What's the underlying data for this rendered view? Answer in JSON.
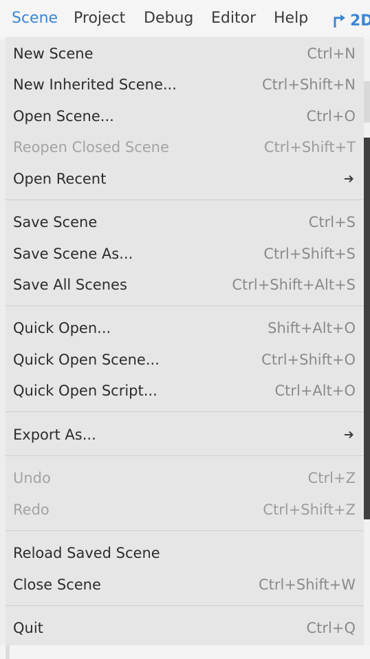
{
  "menubar": {
    "items": [
      {
        "label": "Scene"
      },
      {
        "label": "Project"
      },
      {
        "label": "Debug"
      },
      {
        "label": "Editor"
      },
      {
        "label": "Help"
      }
    ],
    "mode_label": "2D",
    "mode_icon": "2d-mode-icon",
    "accent_color": "#3a86d6"
  },
  "scene_menu": {
    "items": [
      {
        "label": "New Scene",
        "shortcut": "Ctrl+N"
      },
      {
        "label": "New Inherited Scene...",
        "shortcut": "Ctrl+Shift+N"
      },
      {
        "label": "Open Scene...",
        "shortcut": "Ctrl+O"
      },
      {
        "label": "Reopen Closed Scene",
        "shortcut": "Ctrl+Shift+T",
        "disabled": true
      },
      {
        "label": "Open Recent",
        "submenu_icon": "arrow-right-icon"
      },
      {
        "label": "Save Scene",
        "shortcut": "Ctrl+S"
      },
      {
        "label": "Save Scene As...",
        "shortcut": "Ctrl+Shift+S"
      },
      {
        "label": "Save All Scenes",
        "shortcut": "Ctrl+Shift+Alt+S"
      },
      {
        "label": "Quick Open...",
        "shortcut": "Shift+Alt+O"
      },
      {
        "label": "Quick Open Scene...",
        "shortcut": "Ctrl+Shift+O"
      },
      {
        "label": "Quick Open Script...",
        "shortcut": "Ctrl+Alt+O"
      },
      {
        "label": "Export As...",
        "submenu_icon": "arrow-right-icon"
      },
      {
        "label": "Undo",
        "shortcut": "Ctrl+Z",
        "disabled": true
      },
      {
        "label": "Redo",
        "shortcut": "Ctrl+Shift+Z",
        "disabled": true
      },
      {
        "label": "Reload Saved Scene"
      },
      {
        "label": "Close Scene",
        "shortcut": "Ctrl+Shift+W"
      },
      {
        "label": "Quit",
        "shortcut": "Ctrl+Q"
      }
    ]
  }
}
